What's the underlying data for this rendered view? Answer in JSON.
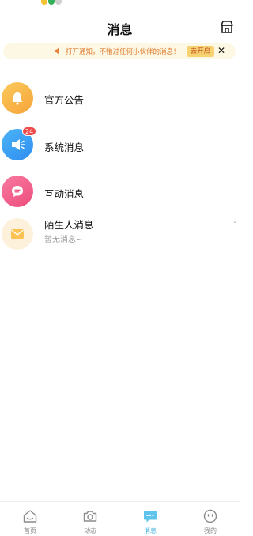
{
  "header": {
    "title": "消息"
  },
  "notice": {
    "text": "打开通知，不错过任何小伙伴的消息！",
    "enable_label": "去开启",
    "close_label": "✕"
  },
  "messages": [
    {
      "label": "官方公告",
      "icon": "bell-icon",
      "color": "#f8b54b"
    },
    {
      "label": "系统消息",
      "icon": "megaphone-icon",
      "color": "#3a9bf2",
      "badge": "24"
    },
    {
      "label": "互动消息",
      "icon": "chat-bubble-icon",
      "color": "#f25f8a"
    },
    {
      "label": "陌生人消息",
      "sub": "暂无消息~",
      "icon": "envelope-icon",
      "color": "#fdf1dc",
      "trailing": "-"
    }
  ],
  "tabs": [
    {
      "label": "首页",
      "icon": "home-icon"
    },
    {
      "label": "动态",
      "icon": "camera-icon"
    },
    {
      "label": "消息",
      "icon": "message-icon",
      "active": true
    },
    {
      "label": "我的",
      "icon": "smiley-icon"
    }
  ]
}
